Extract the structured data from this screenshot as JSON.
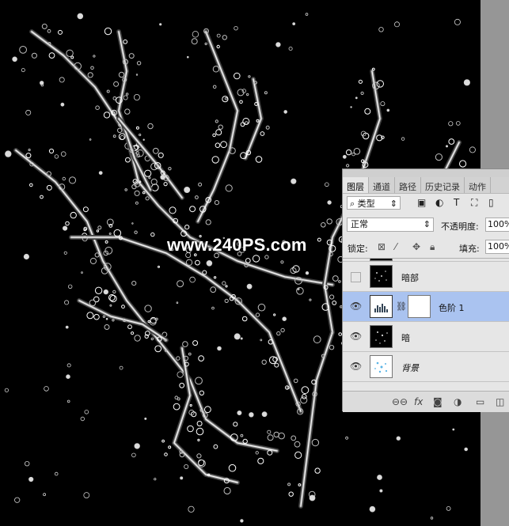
{
  "watermark": "www.240PS.com",
  "panel": {
    "tabs": [
      "图层",
      "通道",
      "路径",
      "历史记录",
      "动作"
    ],
    "filter": {
      "label": "类型",
      "icon": "search-icon"
    },
    "blend_mode": "正常",
    "opacity_label": "不透明度:",
    "opacity_value": "100%",
    "lock_label": "锁定:",
    "fill_label": "填充:",
    "fill_value": "100%",
    "layers": [
      {
        "name": "暗部",
        "visible": false,
        "type": "pixel"
      },
      {
        "name": "色阶 1",
        "visible": true,
        "type": "adjustment",
        "selected": true
      },
      {
        "name": "暗",
        "visible": true,
        "type": "pixel"
      },
      {
        "name": "背景",
        "visible": true,
        "type": "background"
      }
    ]
  },
  "colors": {
    "panel_bg": "#e6e6e6",
    "selected_row": "#aac3f0",
    "canvas": "#000000",
    "gutter": "#969696"
  }
}
